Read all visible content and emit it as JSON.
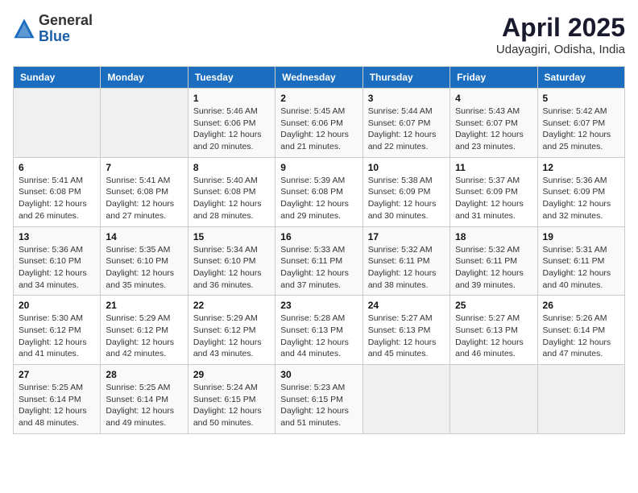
{
  "header": {
    "logo_general": "General",
    "logo_blue": "Blue",
    "month_year": "April 2025",
    "location": "Udayagiri, Odisha, India"
  },
  "days_of_week": [
    "Sunday",
    "Monday",
    "Tuesday",
    "Wednesday",
    "Thursday",
    "Friday",
    "Saturday"
  ],
  "weeks": [
    [
      {
        "day": "",
        "sunrise": "",
        "sunset": "",
        "daylight": ""
      },
      {
        "day": "",
        "sunrise": "",
        "sunset": "",
        "daylight": ""
      },
      {
        "day": "1",
        "sunrise": "Sunrise: 5:46 AM",
        "sunset": "Sunset: 6:06 PM",
        "daylight": "Daylight: 12 hours and 20 minutes."
      },
      {
        "day": "2",
        "sunrise": "Sunrise: 5:45 AM",
        "sunset": "Sunset: 6:06 PM",
        "daylight": "Daylight: 12 hours and 21 minutes."
      },
      {
        "day": "3",
        "sunrise": "Sunrise: 5:44 AM",
        "sunset": "Sunset: 6:07 PM",
        "daylight": "Daylight: 12 hours and 22 minutes."
      },
      {
        "day": "4",
        "sunrise": "Sunrise: 5:43 AM",
        "sunset": "Sunset: 6:07 PM",
        "daylight": "Daylight: 12 hours and 23 minutes."
      },
      {
        "day": "5",
        "sunrise": "Sunrise: 5:42 AM",
        "sunset": "Sunset: 6:07 PM",
        "daylight": "Daylight: 12 hours and 25 minutes."
      }
    ],
    [
      {
        "day": "6",
        "sunrise": "Sunrise: 5:41 AM",
        "sunset": "Sunset: 6:08 PM",
        "daylight": "Daylight: 12 hours and 26 minutes."
      },
      {
        "day": "7",
        "sunrise": "Sunrise: 5:41 AM",
        "sunset": "Sunset: 6:08 PM",
        "daylight": "Daylight: 12 hours and 27 minutes."
      },
      {
        "day": "8",
        "sunrise": "Sunrise: 5:40 AM",
        "sunset": "Sunset: 6:08 PM",
        "daylight": "Daylight: 12 hours and 28 minutes."
      },
      {
        "day": "9",
        "sunrise": "Sunrise: 5:39 AM",
        "sunset": "Sunset: 6:08 PM",
        "daylight": "Daylight: 12 hours and 29 minutes."
      },
      {
        "day": "10",
        "sunrise": "Sunrise: 5:38 AM",
        "sunset": "Sunset: 6:09 PM",
        "daylight": "Daylight: 12 hours and 30 minutes."
      },
      {
        "day": "11",
        "sunrise": "Sunrise: 5:37 AM",
        "sunset": "Sunset: 6:09 PM",
        "daylight": "Daylight: 12 hours and 31 minutes."
      },
      {
        "day": "12",
        "sunrise": "Sunrise: 5:36 AM",
        "sunset": "Sunset: 6:09 PM",
        "daylight": "Daylight: 12 hours and 32 minutes."
      }
    ],
    [
      {
        "day": "13",
        "sunrise": "Sunrise: 5:36 AM",
        "sunset": "Sunset: 6:10 PM",
        "daylight": "Daylight: 12 hours and 34 minutes."
      },
      {
        "day": "14",
        "sunrise": "Sunrise: 5:35 AM",
        "sunset": "Sunset: 6:10 PM",
        "daylight": "Daylight: 12 hours and 35 minutes."
      },
      {
        "day": "15",
        "sunrise": "Sunrise: 5:34 AM",
        "sunset": "Sunset: 6:10 PM",
        "daylight": "Daylight: 12 hours and 36 minutes."
      },
      {
        "day": "16",
        "sunrise": "Sunrise: 5:33 AM",
        "sunset": "Sunset: 6:11 PM",
        "daylight": "Daylight: 12 hours and 37 minutes."
      },
      {
        "day": "17",
        "sunrise": "Sunrise: 5:32 AM",
        "sunset": "Sunset: 6:11 PM",
        "daylight": "Daylight: 12 hours and 38 minutes."
      },
      {
        "day": "18",
        "sunrise": "Sunrise: 5:32 AM",
        "sunset": "Sunset: 6:11 PM",
        "daylight": "Daylight: 12 hours and 39 minutes."
      },
      {
        "day": "19",
        "sunrise": "Sunrise: 5:31 AM",
        "sunset": "Sunset: 6:11 PM",
        "daylight": "Daylight: 12 hours and 40 minutes."
      }
    ],
    [
      {
        "day": "20",
        "sunrise": "Sunrise: 5:30 AM",
        "sunset": "Sunset: 6:12 PM",
        "daylight": "Daylight: 12 hours and 41 minutes."
      },
      {
        "day": "21",
        "sunrise": "Sunrise: 5:29 AM",
        "sunset": "Sunset: 6:12 PM",
        "daylight": "Daylight: 12 hours and 42 minutes."
      },
      {
        "day": "22",
        "sunrise": "Sunrise: 5:29 AM",
        "sunset": "Sunset: 6:12 PM",
        "daylight": "Daylight: 12 hours and 43 minutes."
      },
      {
        "day": "23",
        "sunrise": "Sunrise: 5:28 AM",
        "sunset": "Sunset: 6:13 PM",
        "daylight": "Daylight: 12 hours and 44 minutes."
      },
      {
        "day": "24",
        "sunrise": "Sunrise: 5:27 AM",
        "sunset": "Sunset: 6:13 PM",
        "daylight": "Daylight: 12 hours and 45 minutes."
      },
      {
        "day": "25",
        "sunrise": "Sunrise: 5:27 AM",
        "sunset": "Sunset: 6:13 PM",
        "daylight": "Daylight: 12 hours and 46 minutes."
      },
      {
        "day": "26",
        "sunrise": "Sunrise: 5:26 AM",
        "sunset": "Sunset: 6:14 PM",
        "daylight": "Daylight: 12 hours and 47 minutes."
      }
    ],
    [
      {
        "day": "27",
        "sunrise": "Sunrise: 5:25 AM",
        "sunset": "Sunset: 6:14 PM",
        "daylight": "Daylight: 12 hours and 48 minutes."
      },
      {
        "day": "28",
        "sunrise": "Sunrise: 5:25 AM",
        "sunset": "Sunset: 6:14 PM",
        "daylight": "Daylight: 12 hours and 49 minutes."
      },
      {
        "day": "29",
        "sunrise": "Sunrise: 5:24 AM",
        "sunset": "Sunset: 6:15 PM",
        "daylight": "Daylight: 12 hours and 50 minutes."
      },
      {
        "day": "30",
        "sunrise": "Sunrise: 5:23 AM",
        "sunset": "Sunset: 6:15 PM",
        "daylight": "Daylight: 12 hours and 51 minutes."
      },
      {
        "day": "",
        "sunrise": "",
        "sunset": "",
        "daylight": ""
      },
      {
        "day": "",
        "sunrise": "",
        "sunset": "",
        "daylight": ""
      },
      {
        "day": "",
        "sunrise": "",
        "sunset": "",
        "daylight": ""
      }
    ]
  ]
}
